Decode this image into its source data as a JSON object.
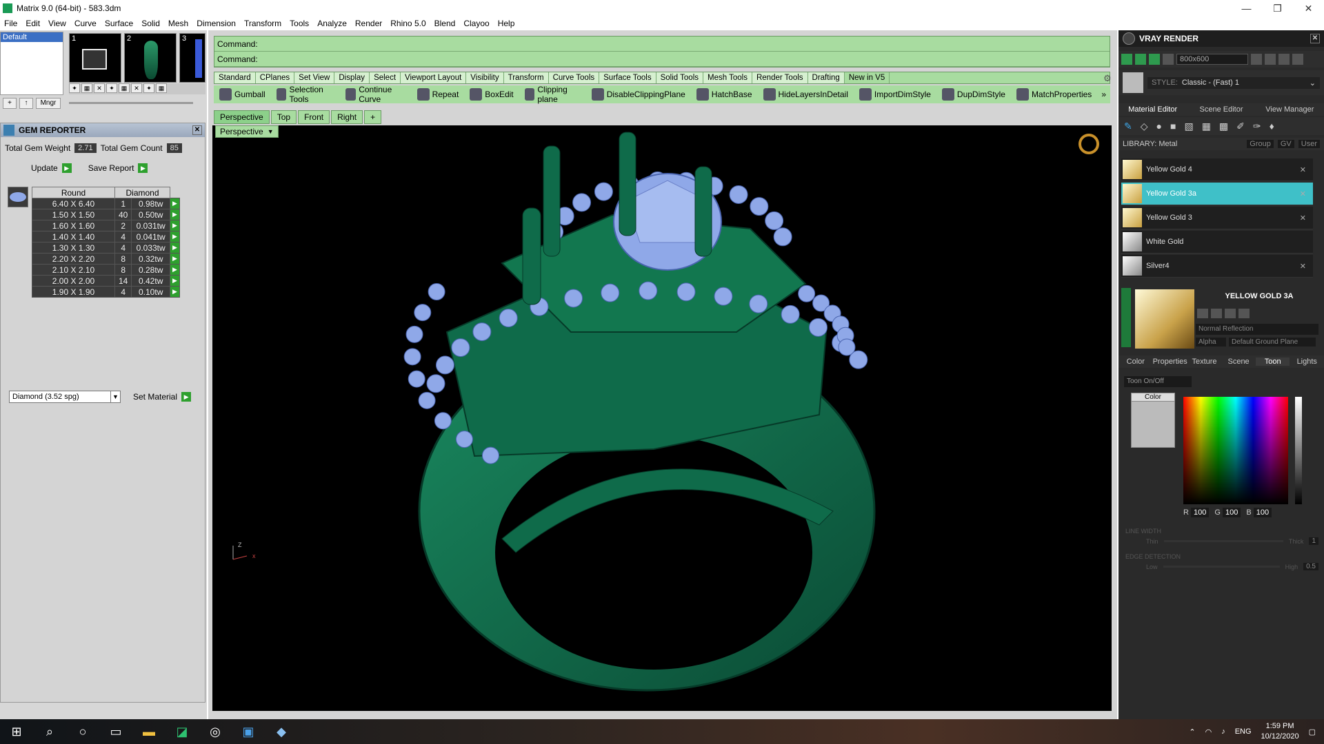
{
  "window": {
    "title": "Matrix 9.0 (64-bit) - 583.3dm",
    "min": "—",
    "max": "❐",
    "close": "✕"
  },
  "menu": [
    "File",
    "Edit",
    "View",
    "Curve",
    "Surface",
    "Solid",
    "Mesh",
    "Dimension",
    "Transform",
    "Tools",
    "Analyze",
    "Render",
    "Rhino 5.0",
    "Blend",
    "Clayoo",
    "Help"
  ],
  "layers": {
    "selected": "Default",
    "mngr": "Mngr",
    "thumbs": [
      "1",
      "2",
      "3"
    ]
  },
  "gem": {
    "title": "GEM REPORTER",
    "weight_label": "Total Gem Weight",
    "weight": "2.71",
    "count_label": "Total Gem Count",
    "count": "85",
    "update": "Update",
    "save": "Save Report",
    "headers": [
      "Round",
      "Diamond"
    ],
    "rows": [
      {
        "size": "6.40 X 6.40",
        "qty": "1",
        "wt": "0.98tw"
      },
      {
        "size": "1.50 X 1.50",
        "qty": "40",
        "wt": "0.50tw"
      },
      {
        "size": "1.60 X 1.60",
        "qty": "2",
        "wt": "0.031tw"
      },
      {
        "size": "1.40 X 1.40",
        "qty": "4",
        "wt": "0.041tw"
      },
      {
        "size": "1.30 X 1.30",
        "qty": "4",
        "wt": "0.033tw"
      },
      {
        "size": "2.20 X 2.20",
        "qty": "8",
        "wt": "0.32tw"
      },
      {
        "size": "2.10 X 2.10",
        "qty": "8",
        "wt": "0.28tw"
      },
      {
        "size": "2.00 X 2.00",
        "qty": "14",
        "wt": "0.42tw"
      },
      {
        "size": "1.90 X 1.90",
        "qty": "4",
        "wt": "0.10tw"
      }
    ],
    "material": "Diamond   (3.52 spg)",
    "set_material": "Set Material"
  },
  "command": {
    "line1": "Command:",
    "line2": "Command:"
  },
  "toolbar_tabs": [
    "Standard",
    "CPlanes",
    "Set View",
    "Display",
    "Select",
    "Viewport Layout",
    "Visibility",
    "Transform",
    "Curve Tools",
    "Surface Tools",
    "Solid Tools",
    "Mesh Tools",
    "Render Tools",
    "Drafting",
    "New in V5"
  ],
  "tools": [
    "Gumball",
    "Selection Tools",
    "Continue Curve",
    "Repeat",
    "BoxEdit",
    "Clipping plane",
    "DisableClippingPlane",
    "HatchBase",
    "HideLayersInDetail",
    "ImportDimStyle",
    "DupDimStyle",
    "MatchProperties"
  ],
  "tools_more": "»",
  "viewport_tabs": [
    "Perspective",
    "Top",
    "Front",
    "Right",
    "+"
  ],
  "viewport_label": "Perspective",
  "viewport_axes": {
    "z": "Z",
    "x": "x"
  },
  "vray": {
    "title": "VRAY RENDER",
    "resolution": "800x600",
    "style_label": "STYLE:",
    "style": "Classic - (Fast) 1",
    "tabs": [
      "Material Editor",
      "Scene Editor",
      "View Manager"
    ],
    "library": "LIBRARY: Metal",
    "lib_controls": [
      "Group",
      "GV",
      "User"
    ],
    "materials": [
      {
        "name": "Yellow Gold 4",
        "sel": false,
        "del": "✕"
      },
      {
        "name": "Yellow Gold 3a",
        "sel": true,
        "del": "✕"
      },
      {
        "name": "Yellow Gold 3",
        "sel": false,
        "del": "✕"
      },
      {
        "name": "White Gold",
        "sel": false,
        "del": ""
      },
      {
        "name": "Silver4",
        "sel": false,
        "del": "✕"
      }
    ],
    "preview_name": "YELLOW GOLD 3A",
    "reflection": "Normal Reflection",
    "alpha": "Alpha",
    "ground": "Default Ground Plane",
    "sub_tabs": [
      "Color",
      "Properties",
      "Texture",
      "Scene",
      "Toon",
      "Lights"
    ],
    "toon_toggle": "Toon On/Off",
    "color_label": "Color",
    "rgb": {
      "r": "100",
      "g": "100",
      "b": "100"
    },
    "line_width": "LINE WIDTH",
    "thin": "Thin",
    "thick": "Thick",
    "line_val": "1",
    "edge": "EDGE DETECTION",
    "low": "Low",
    "high": "High",
    "edge_val": "0.5"
  },
  "taskbar": {
    "lang": "ENG",
    "time": "1:59 PM",
    "date": "10/12/2020"
  },
  "colors": {
    "command_bg": "#a8dca0",
    "ring": "#0f6b4a",
    "gem": "#8fa8e8",
    "selected_material": "#3fc0c8"
  }
}
